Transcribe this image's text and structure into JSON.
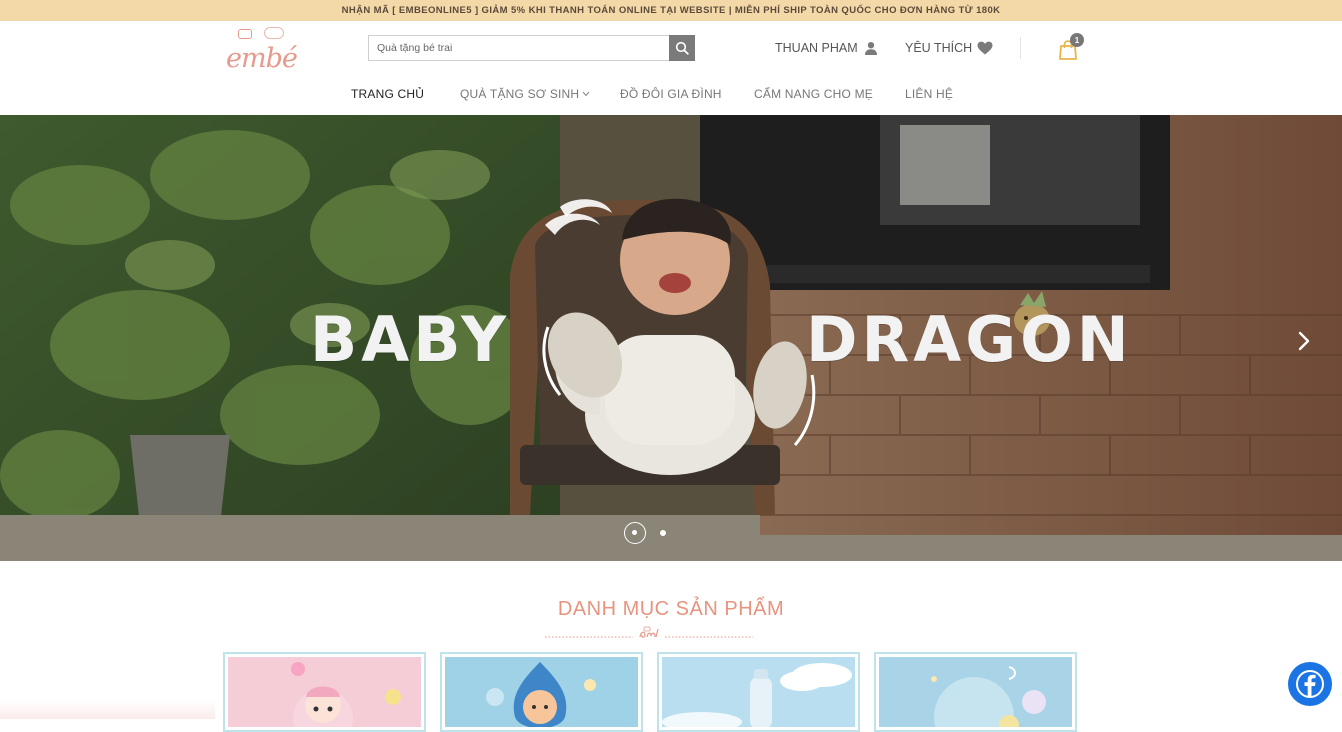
{
  "topbar": {
    "promo_text": "NHẬN MÃ [ EMBEONLINE5 ] GIẢM 5% KHI THANH TOÁN ONLINE TẠI WEBSITE | MIỄN PHÍ SHIP TOÀN QUỐC CHO ĐƠN HÀNG TỪ 180K"
  },
  "header": {
    "logo_text": "embé",
    "search": {
      "placeholder": "Quà tặng bé trai",
      "icon": "search-icon"
    },
    "account_label": "THUAN PHAM",
    "account_icon": "user-icon",
    "wishlist_label": "YÊU THÍCH",
    "wishlist_icon": "heart-icon",
    "cart_icon": "shopping-bag-icon",
    "cart_count": "1"
  },
  "nav": {
    "items": [
      {
        "label": "TRANG CHỦ",
        "active": true
      },
      {
        "label": "QUÀ TẶNG SƠ SINH",
        "dropdown": true
      },
      {
        "label": "ĐỒ ĐÔI GIA ĐÌNH"
      },
      {
        "label": "CẨM NANG CHO MẸ"
      },
      {
        "label": "LIÊN HỆ"
      }
    ]
  },
  "hero": {
    "title_left": "BABY",
    "title_right": "DRAGON",
    "next_icon": "chevron-right-icon",
    "slide_count": 2,
    "active_slide": 1
  },
  "categories": {
    "title": "DANH MỤC SẢN PHẨM"
  },
  "floating": {
    "facebook_icon": "facebook-icon"
  },
  "colors": {
    "topbar_bg": "#f3d8a8",
    "accent_pink": "#e9937f",
    "card_border": "#bfe3ea",
    "facebook_blue": "#1b74e4"
  }
}
